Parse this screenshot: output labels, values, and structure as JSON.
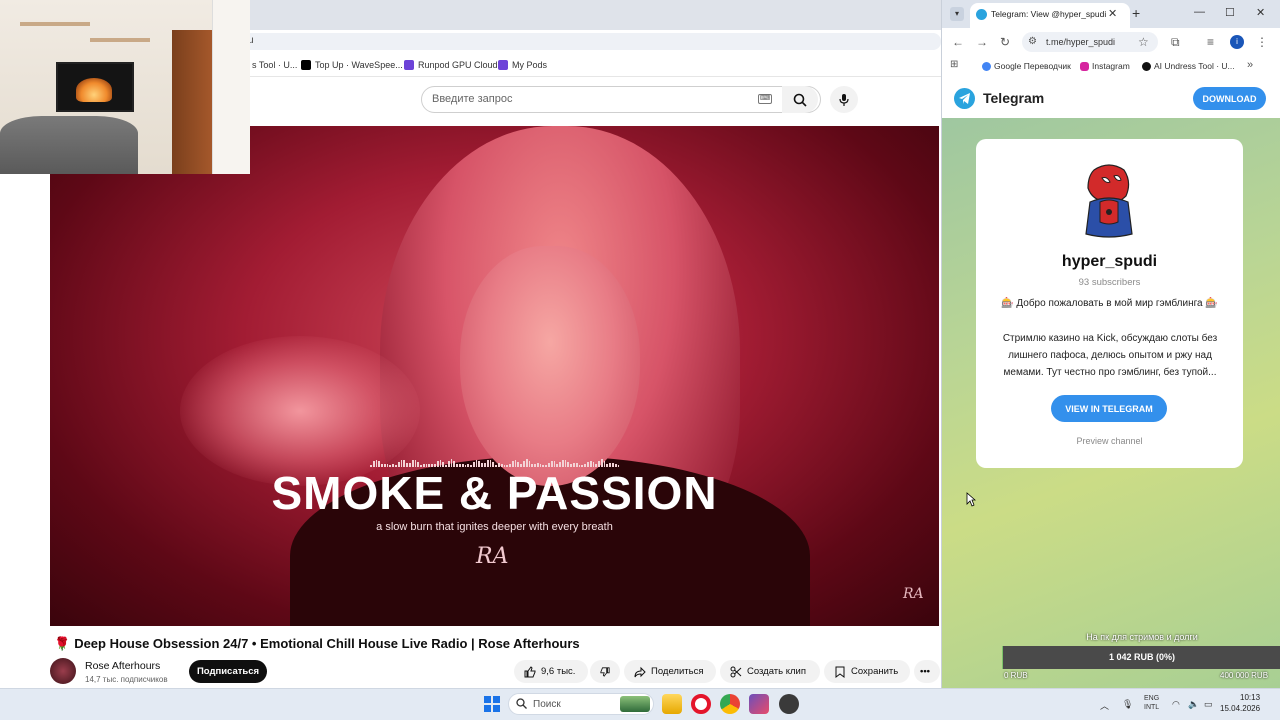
{
  "youtube": {
    "address_partial": "u",
    "bookmarks": [
      {
        "label": "s Tool · U...",
        "color": "#444444"
      },
      {
        "label": "Top Up · WaveSpee...",
        "color": "#000000"
      },
      {
        "label": "Runpod GPU Cloud",
        "color": "#6d43d8"
      },
      {
        "label": "My Pods",
        "color": "#6d43d8"
      }
    ],
    "search_placeholder": "Введите запрос",
    "video": {
      "overlay_title": "SMOKE & PASSION",
      "overlay_subtitle": "a slow burn that ignites deeper with every breath",
      "signature": "RA"
    },
    "title": "Deep House Obsession 24/7 • Emotional Chill House Live Radio | Rose Afterhours",
    "channel": {
      "name": "Rose Afterhours",
      "subscribers": "14,7 тыс. подписчиков",
      "subscribe_label": "Подписаться"
    },
    "actions": {
      "likes": "9,6 тыс.",
      "share": "Поделиться",
      "clip": "Создать клип",
      "save": "Сохранить"
    }
  },
  "telegram_browser": {
    "tab_title": "Telegram: View @hyper_spudi",
    "url": "t.me/hyper_spudi",
    "bookmarks": [
      {
        "label": "Google Переводчик",
        "color": "#4285f4"
      },
      {
        "label": "Instagram",
        "color": "#d6249f"
      },
      {
        "label": "AI Undress Tool · U...",
        "color": "#111111"
      }
    ],
    "header": {
      "app_name": "Telegram",
      "download_label": "DOWNLOAD"
    },
    "channel": {
      "name": "hyper_spudi",
      "subscribers": "93 subscribers",
      "welcome": "🎰 Добро пожаловать в мой мир гэмблинга 🎰",
      "description": "Стримлю казино на Kick, обсуждаю слоты без лишнего пафоса, делюсь опытом и ржу над мемами. Тут честно про гэмблинг, без тупой...",
      "view_label": "VIEW IN TELEGRAM",
      "preview_label": "Preview channel"
    }
  },
  "donation_widget": {
    "label": "На пк для стримов и долги",
    "progress_text": "1 042 RUB (0%)",
    "progress_fraction": 0.0026,
    "min": "0 RUB",
    "max": "400 000 RUB"
  },
  "taskbar": {
    "search_placeholder": "Поиск",
    "lang_top": "ENG",
    "lang_bottom": "INTL",
    "time": "10:13",
    "date": "15.04.2026"
  },
  "colors": {
    "telegram_blue": "#3390ec",
    "youtube_black": "#0f0f0f"
  }
}
